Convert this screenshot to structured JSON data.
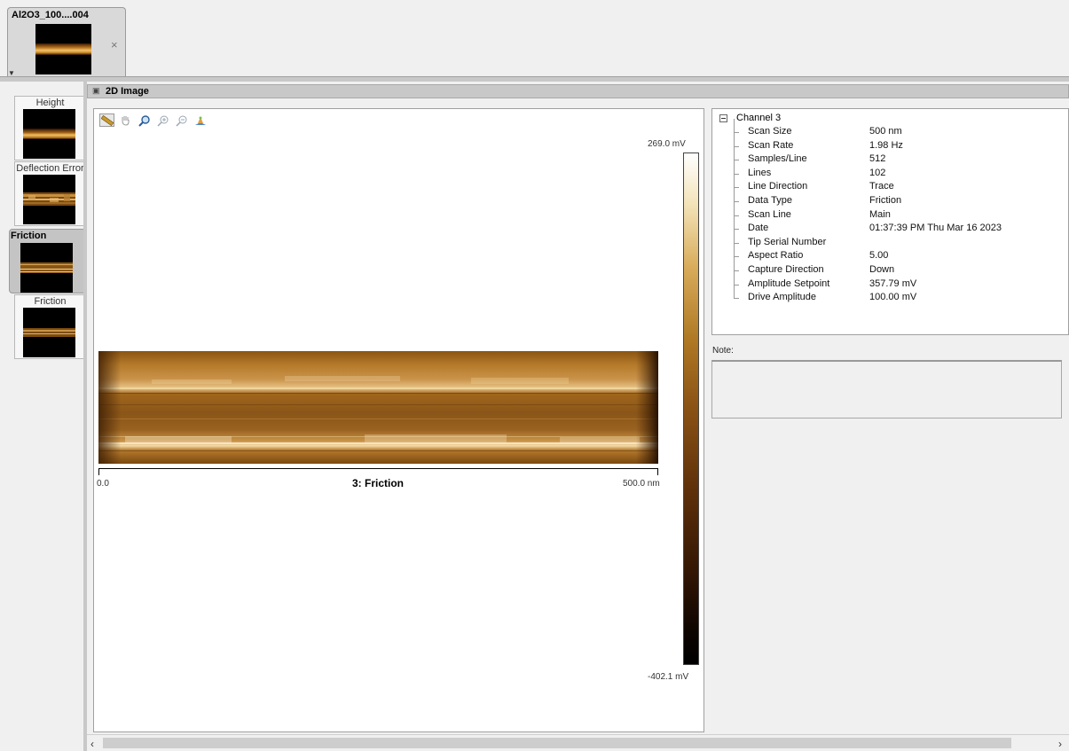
{
  "file_tab": {
    "title": "Al2O3_100....004",
    "close": "×"
  },
  "channels": [
    {
      "label": "Height",
      "selected": false
    },
    {
      "label": "Deflection Error",
      "selected": false
    },
    {
      "label": "Friction",
      "selected": true
    },
    {
      "label": "Friction",
      "selected": false
    }
  ],
  "panel": {
    "title": "2D Image"
  },
  "toolbar": {
    "tools": [
      "ruler-icon",
      "pan-hand-icon",
      "zoom-icon",
      "zoom-in-icon",
      "zoom-out-icon",
      "3d-view-icon"
    ]
  },
  "image": {
    "title": "3: Friction",
    "scale_min": "0.0",
    "scale_max": "500.0 nm",
    "colorbar_max": "269.0 mV",
    "colorbar_min": "-402.1 mV"
  },
  "properties": {
    "root": "Channel 3",
    "rows": [
      {
        "name": "Scan Size",
        "value": "500 nm"
      },
      {
        "name": "Scan Rate",
        "value": "1.98 Hz"
      },
      {
        "name": "Samples/Line",
        "value": "512"
      },
      {
        "name": "Lines",
        "value": "102"
      },
      {
        "name": "Line Direction",
        "value": "Trace"
      },
      {
        "name": "Data Type",
        "value": "Friction"
      },
      {
        "name": "Scan Line",
        "value": "Main"
      },
      {
        "name": "Date",
        "value": "01:37:39 PM Thu Mar 16 2023"
      },
      {
        "name": "Tip Serial Number",
        "value": ""
      },
      {
        "name": "Aspect Ratio",
        "value": "5.00"
      },
      {
        "name": "Capture Direction",
        "value": "Down"
      },
      {
        "name": "Amplitude Setpoint",
        "value": "357.79 mV"
      },
      {
        "name": "Drive Amplitude",
        "value": "100.00 mV"
      }
    ]
  },
  "note": {
    "label": "Note:"
  },
  "colors": {
    "accent": "#b07a25",
    "header_bg": "#c8c8c8",
    "selected_card": "#c4c4c4"
  }
}
